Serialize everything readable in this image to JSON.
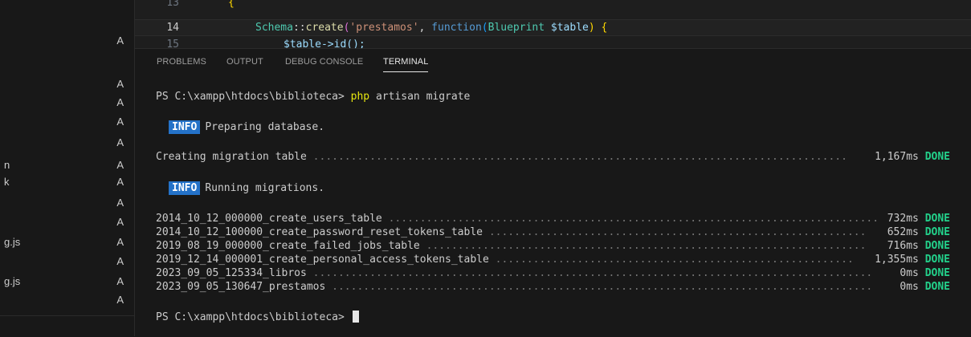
{
  "sidebar": {
    "rows": [
      {
        "name": "",
        "status": "A"
      },
      {
        "name": "",
        "status": "A"
      },
      {
        "name": "",
        "status": "A"
      },
      {
        "name": "",
        "status": "A"
      },
      {
        "name": "",
        "status": "A"
      },
      {
        "name": "n",
        "status": "A"
      },
      {
        "name": "k",
        "status": "A"
      },
      {
        "name": "",
        "status": "A"
      },
      {
        "name": "",
        "status": "A"
      },
      {
        "name": "g.js",
        "status": "A"
      },
      {
        "name": "",
        "status": "A"
      },
      {
        "name": "g.js",
        "status": "A"
      },
      {
        "name": "",
        "status": "A"
      }
    ]
  },
  "editor": {
    "lines": [
      {
        "number": "13",
        "code": "{"
      },
      {
        "number": "14",
        "code_parts": [
          "Schema",
          "::",
          "create",
          "(",
          "'prestamos'",
          ", ",
          "function",
          "(",
          "Blueprint",
          " $table",
          ") {"
        ]
      },
      {
        "number": "15",
        "code": "$table->id();"
      }
    ]
  },
  "panel": {
    "tabs": [
      "PROBLEMS",
      "OUTPUT",
      "DEBUG CONSOLE",
      "TERMINAL"
    ],
    "active_tab": "TERMINAL"
  },
  "terminal": {
    "prompt": "PS C:\\xampp\\htdocs\\biblioteca>",
    "command_php": "php",
    "command_rest": " artisan migrate",
    "info_label": "INFO",
    "info_preparing": "Preparing database.",
    "creating_label": "Creating migration table",
    "creating_time": "1,167ms",
    "done_label": "DONE",
    "info_running": "Running migrations.",
    "migrations": [
      {
        "name": "2014_10_12_000000_create_users_table",
        "time": "732ms"
      },
      {
        "name": "2014_10_12_100000_create_password_reset_tokens_table",
        "time": "652ms"
      },
      {
        "name": "2019_08_19_000000_create_failed_jobs_table",
        "time": "716ms"
      },
      {
        "name": "2019_12_14_000001_create_personal_access_tokens_table",
        "time": "1,355ms"
      },
      {
        "name": "2023_09_05_125334_libros",
        "time": "0ms"
      },
      {
        "name": "2023_09_05_130647_prestamos",
        "time": "0ms"
      }
    ],
    "final_prompt": "PS C:\\xampp\\htdocs\\biblioteca>"
  },
  "colors": {
    "badge": "#2472c8",
    "done": "#23d18b",
    "php": "#e5e510"
  }
}
